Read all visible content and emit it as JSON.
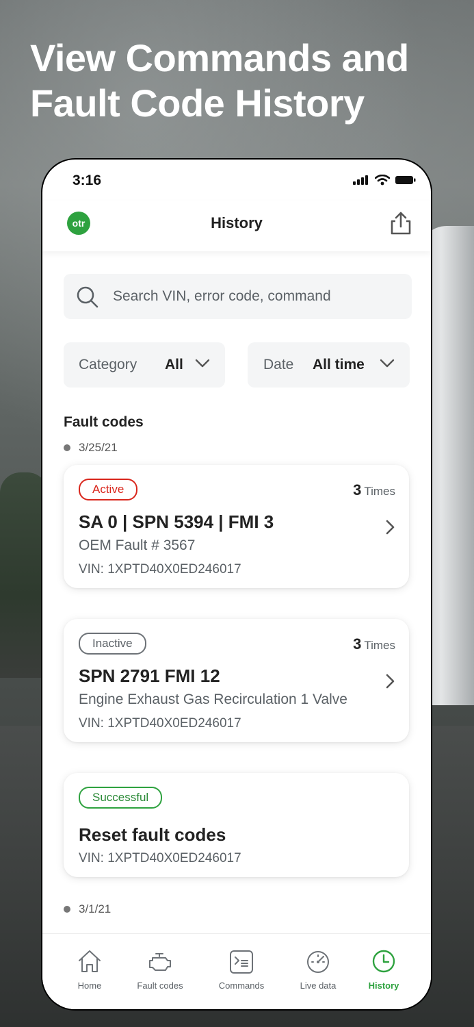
{
  "headline": "View Commands and Fault Code History",
  "status_bar": {
    "time": "3:16"
  },
  "nav": {
    "logo_text": "otr",
    "title": "History"
  },
  "search": {
    "placeholder": "Search VIN, error code, command"
  },
  "filters": {
    "category": {
      "label": "Category",
      "value": "All"
    },
    "date": {
      "label": "Date",
      "value": "All time"
    }
  },
  "section_title": "Fault codes",
  "date_groups": [
    "3/25/21",
    "3/1/21"
  ],
  "cards": [
    {
      "status": "Active",
      "count": "3",
      "count_unit": "Times",
      "title": "SA 0 | SPN 5394 | FMI 3",
      "subtitle": "OEM Fault # 3567",
      "vin": "VIN: 1XPTD40X0ED246017"
    },
    {
      "status": "Inactive",
      "count": "3",
      "count_unit": "Times",
      "title": "SPN 2791 FMI 12",
      "subtitle": "Engine Exhaust Gas Recirculation 1 Valve",
      "vin": "VIN: 1XPTD40X0ED246017"
    },
    {
      "status": "Successful",
      "title": "Reset fault codes",
      "vin": "VIN: 1XPTD40X0ED246017"
    }
  ],
  "tabs": [
    {
      "label": "Home",
      "icon": "home-icon"
    },
    {
      "label": "Fault codes",
      "icon": "engine-icon"
    },
    {
      "label": "Commands",
      "icon": "terminal-icon"
    },
    {
      "label": "Live data",
      "icon": "gauge-icon"
    },
    {
      "label": "History",
      "icon": "clock-icon",
      "active": true
    }
  ],
  "colors": {
    "accent": "#2ea23f",
    "active_red": "#d9261c",
    "inactive_gray": "#6d7277"
  }
}
